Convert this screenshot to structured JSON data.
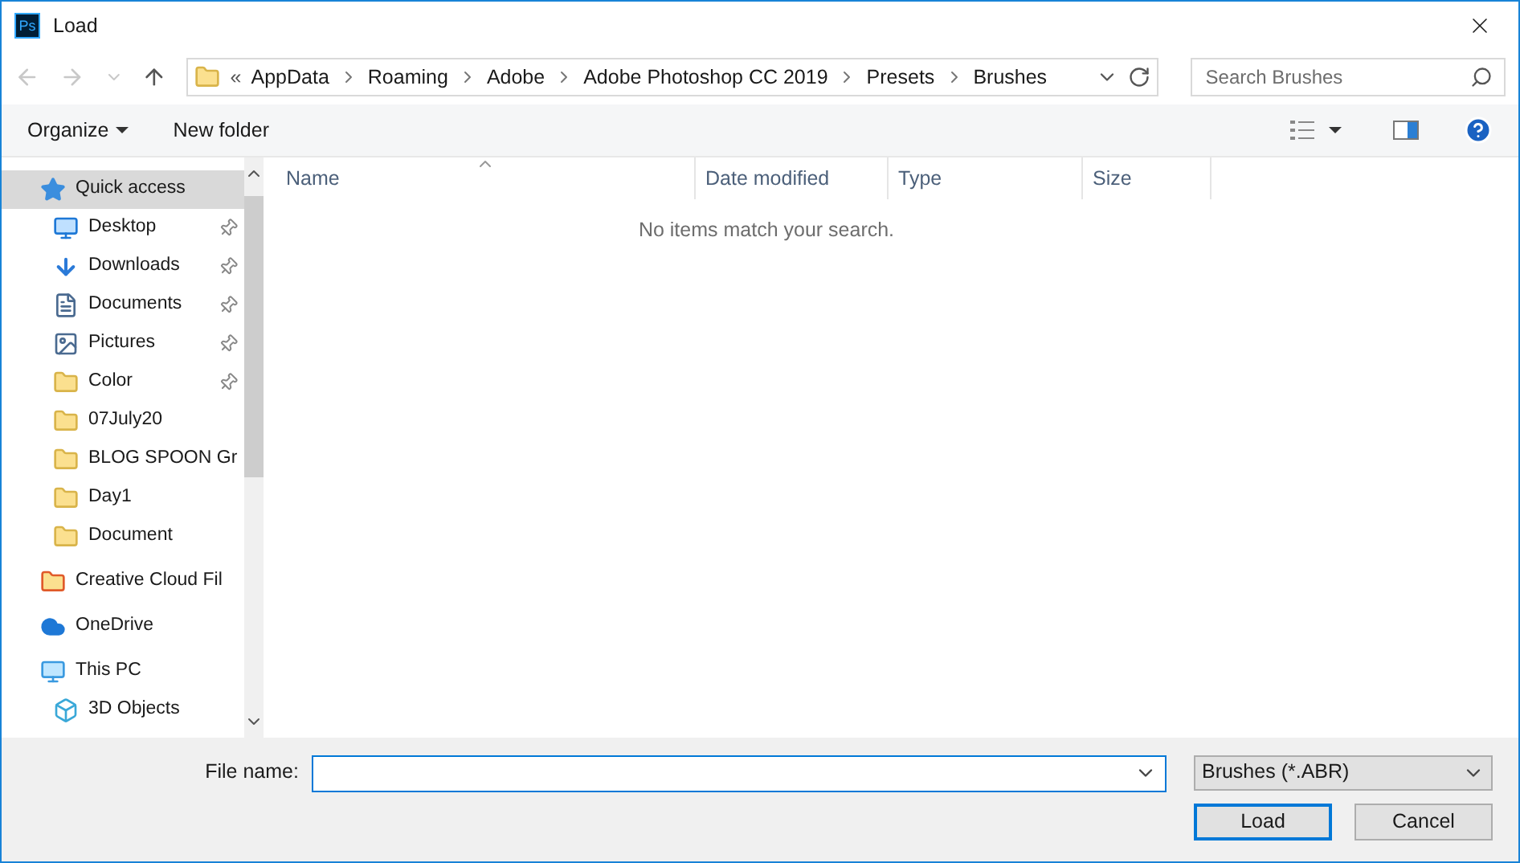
{
  "window": {
    "title": "Load",
    "app_icon_text": "Ps"
  },
  "address_bar": {
    "overflow": "«",
    "path": [
      "AppData",
      "Roaming",
      "Adobe",
      "Adobe Photoshop CC 2019",
      "Presets",
      "Brushes"
    ]
  },
  "search": {
    "placeholder": "Search Brushes"
  },
  "toolbar": {
    "organize": "Organize",
    "new_folder": "New folder"
  },
  "sidebar": [
    {
      "label": "Quick access",
      "kind": "star",
      "selected": true,
      "children": [
        {
          "label": "Desktop",
          "kind": "desktop",
          "pinned": true
        },
        {
          "label": "Downloads",
          "kind": "download",
          "pinned": true
        },
        {
          "label": "Documents",
          "kind": "document",
          "pinned": true
        },
        {
          "label": "Pictures",
          "kind": "picture",
          "pinned": true
        },
        {
          "label": "Color",
          "kind": "folder",
          "pinned": true
        },
        {
          "label": "07July20",
          "kind": "folder",
          "pinned": false
        },
        {
          "label": "BLOG SPOON Gr",
          "kind": "folder",
          "pinned": false
        },
        {
          "label": "Day1",
          "kind": "folder",
          "pinned": false
        },
        {
          "label": "Document",
          "kind": "folder",
          "pinned": false
        }
      ]
    },
    {
      "label": "Creative Cloud Fil",
      "kind": "cloud-folder",
      "selected": false
    },
    {
      "label": "OneDrive",
      "kind": "onedrive",
      "selected": false
    },
    {
      "label": "This PC",
      "kind": "pc",
      "selected": false,
      "children": [
        {
          "label": "3D Objects",
          "kind": "cube",
          "pinned": false
        }
      ]
    }
  ],
  "table": {
    "columns": [
      "Name",
      "Date modified",
      "Type",
      "Size"
    ],
    "empty_message": "No items match your search."
  },
  "file_name": {
    "label": "File name:"
  },
  "file_type": {
    "value": "Brushes (*.ABR)"
  },
  "buttons": [
    "Load",
    "Cancel"
  ]
}
